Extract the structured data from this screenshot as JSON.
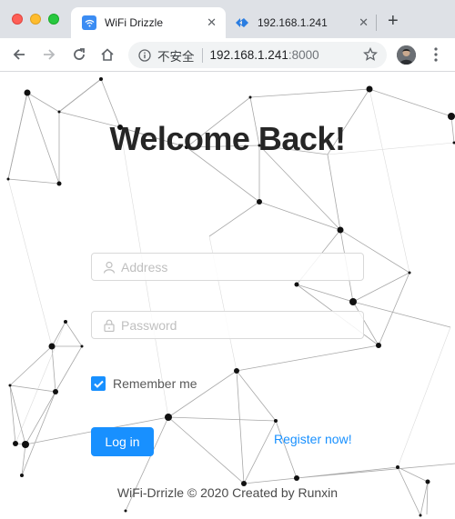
{
  "browser": {
    "tabs": [
      {
        "title": "WiFi Drizzle",
        "active": true,
        "icon": "wifi-icon"
      },
      {
        "title": "192.168.1.241",
        "active": false,
        "icon": "vscode-icon"
      }
    ],
    "address": {
      "security_label": "不安全",
      "host": "192.168.1.241",
      "port": ":8000"
    }
  },
  "page": {
    "title": "Welcome Back!",
    "address_placeholder": "Address",
    "password_placeholder": "Password",
    "remember_label": "Remember me",
    "remember_checked": true,
    "login_label": "Log in",
    "register_label": "Register now!",
    "footer": "WiFi-Drrizle © 2020 Created by Runxin"
  },
  "colors": {
    "primary": "#1890ff",
    "title": "#262626"
  }
}
